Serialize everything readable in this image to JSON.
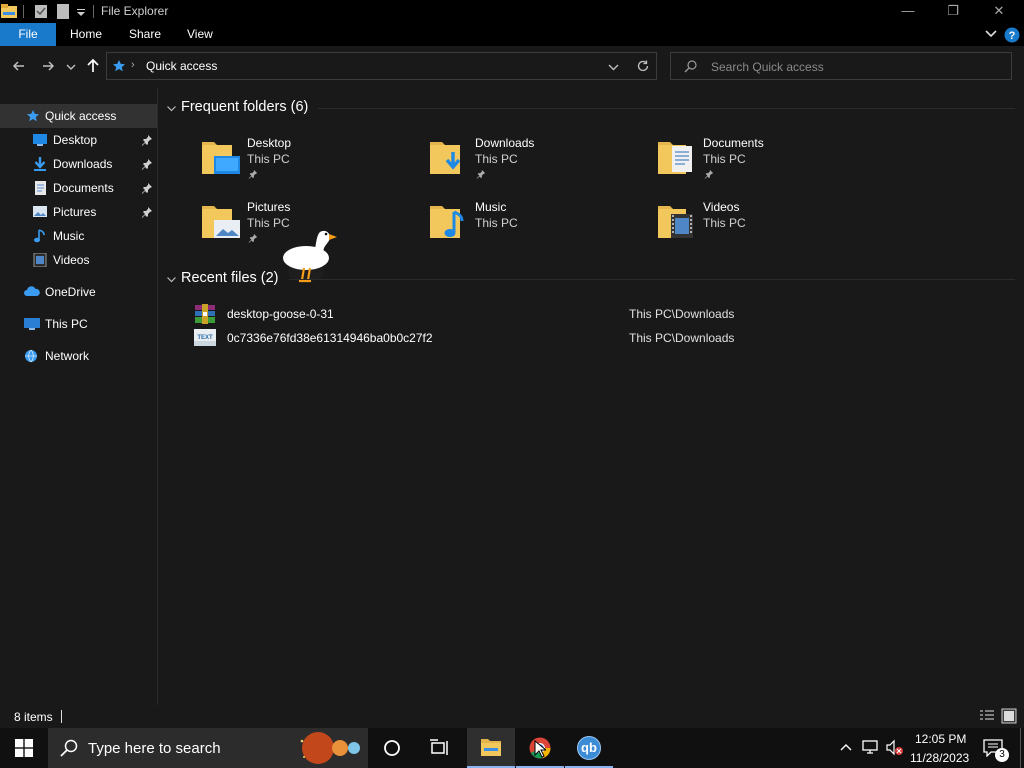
{
  "window": {
    "title": "File Explorer",
    "controls": {
      "minimize": "—",
      "maximize": "❐",
      "close": "✕"
    }
  },
  "ribbon": {
    "tabs": [
      "File",
      "Home",
      "Share",
      "View"
    ]
  },
  "address": {
    "location": "Quick access",
    "search_placeholder": "Search Quick access"
  },
  "nav": {
    "quick_access": "Quick access",
    "pinned": [
      {
        "label": "Desktop",
        "pinned": true
      },
      {
        "label": "Downloads",
        "pinned": true
      },
      {
        "label": "Documents",
        "pinned": true
      },
      {
        "label": "Pictures",
        "pinned": true
      },
      {
        "label": "Music",
        "pinned": false
      },
      {
        "label": "Videos",
        "pinned": false
      }
    ],
    "onedrive": "OneDrive",
    "this_pc": "This PC",
    "network": "Network"
  },
  "frequent": {
    "header": "Frequent folders (6)",
    "folders": [
      {
        "name": "Desktop",
        "location": "This PC",
        "pinned": true
      },
      {
        "name": "Downloads",
        "location": "This PC",
        "pinned": true
      },
      {
        "name": "Documents",
        "location": "This PC",
        "pinned": true
      },
      {
        "name": "Pictures",
        "location": "This PC",
        "pinned": true
      },
      {
        "name": "Music",
        "location": "This PC",
        "pinned": false
      },
      {
        "name": "Videos",
        "location": "This PC",
        "pinned": false
      }
    ]
  },
  "recent": {
    "header": "Recent files (2)",
    "files": [
      {
        "name": "desktop-goose-0-31",
        "path": "This PC\\Downloads",
        "icon": "archive-icon"
      },
      {
        "name": "0c7336e76fd38e61314946ba0b0c27f2",
        "path": "This PC\\Downloads",
        "icon": "text-file-icon"
      }
    ]
  },
  "status": {
    "items": "8 items"
  },
  "taskbar": {
    "search_placeholder": "Type here to search",
    "qb_label": "qb",
    "time": "12:05 PM",
    "date": "11/28/2023",
    "notifications": "3"
  },
  "colors": {
    "accent": "#1979ca",
    "folder": "#f2c75c",
    "background": "#191919"
  }
}
